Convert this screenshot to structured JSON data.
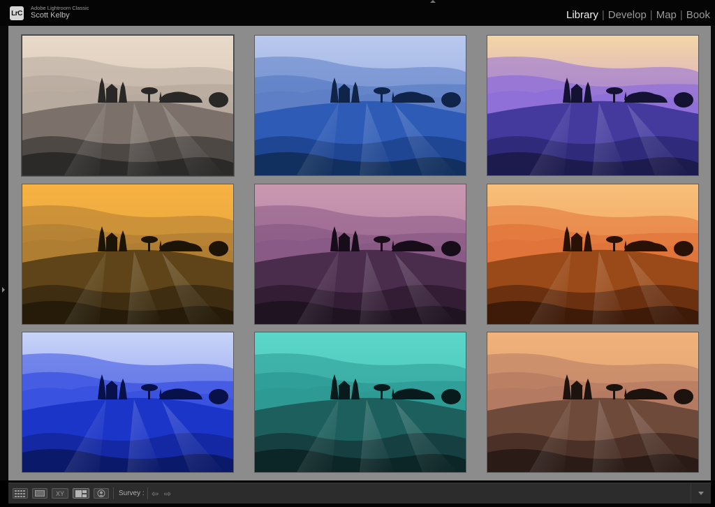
{
  "app": {
    "logo_text": "LrC",
    "product_name": "Adobe Lightroom Classic",
    "user_name": "Scott Kelby"
  },
  "modules": [
    {
      "label": "Library",
      "active": true
    },
    {
      "label": "Develop",
      "active": false
    },
    {
      "label": "Map",
      "active": false
    },
    {
      "label": "Book",
      "active": false
    }
  ],
  "photos": [
    {
      "variant": "neutral",
      "sky_top": "#e8d9c9",
      "sky_bottom": "#cdbeae",
      "far": "#b7aa9e",
      "mid": "#7b716a",
      "near": "#4e4845",
      "fore": "#2c2a29",
      "silhouette": "#2a2826"
    },
    {
      "variant": "blue",
      "sky_top": "#b9c8ee",
      "sky_bottom": "#7e9bd6",
      "far": "#5e7fc6",
      "mid": "#2d5bb5",
      "near": "#1f4693",
      "fore": "#12305f",
      "silhouette": "#0f2448"
    },
    {
      "variant": "violet",
      "sky_top": "#f2d6a6",
      "sky_bottom": "#c07fe0",
      "far": "#8f6fd8",
      "mid": "#443a9e",
      "near": "#2f2a7a",
      "fore": "#1d1a4e",
      "silhouette": "#141232"
    },
    {
      "variant": "amber",
      "sky_top": "#f7b242",
      "sky_bottom": "#d99a3a",
      "far": "#b07e33",
      "mid": "#5e4418",
      "near": "#3e2d10",
      "fore": "#261b08",
      "silhouette": "#1c1407"
    },
    {
      "variant": "mauve",
      "sky_top": "#c998b0",
      "sky_bottom": "#a8739a",
      "far": "#8a5a86",
      "mid": "#4a2c4c",
      "near": "#331d35",
      "fore": "#1f1221",
      "silhouette": "#170d18"
    },
    {
      "variant": "orange",
      "sky_top": "#f7c07a",
      "sky_bottom": "#f08a4a",
      "far": "#e0743a",
      "mid": "#9a4a18",
      "near": "#6a3010",
      "fore": "#3e1a08",
      "silhouette": "#2a1106"
    },
    {
      "variant": "ultramarine",
      "sky_top": "#c8d4f8",
      "sky_bottom": "#6a7cf0",
      "far": "#3a52e0",
      "mid": "#1b35c8",
      "near": "#1328a2",
      "fore": "#0b196a",
      "silhouette": "#08114a"
    },
    {
      "variant": "teal",
      "sky_top": "#5cd6c8",
      "sky_bottom": "#3ab8b0",
      "far": "#2e9a94",
      "mid": "#1d5f5c",
      "near": "#153f40",
      "fore": "#0c2526",
      "silhouette": "#081a1b"
    },
    {
      "variant": "copper",
      "sky_top": "#f0b27a",
      "sky_bottom": "#d89470",
      "far": "#b57a62",
      "mid": "#6e4a3a",
      "near": "#4a3026",
      "fore": "#2a1b16",
      "silhouette": "#1c120e"
    }
  ],
  "toolbar": {
    "grid_icon": "grid-view-icon",
    "loupe_icon": "loupe-view-icon",
    "compare_label": "XY",
    "survey_icon": "survey-view-icon",
    "people_icon": "people-view-icon",
    "survey_label": "Survey :",
    "prev_arrow": "⇦",
    "next_arrow": "⇨"
  }
}
